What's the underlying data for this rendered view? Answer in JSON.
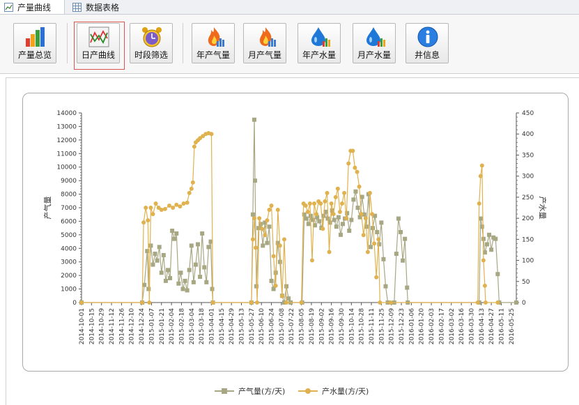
{
  "tabs": [
    {
      "label": "产量曲线",
      "icon": "chart-icon",
      "active": true
    },
    {
      "label": "数据表格",
      "icon": "table-icon",
      "active": false
    }
  ],
  "toolbar": {
    "buttons": [
      {
        "label": "产量总览",
        "icon": "bar-chart-icon"
      },
      {
        "label": "日产曲线",
        "icon": "line-chart-icon",
        "selected": true
      },
      {
        "label": "时段筛选",
        "icon": "alarm-clock-icon"
      },
      {
        "label": "年产气量",
        "icon": "flame-icon"
      },
      {
        "label": "月产气量",
        "icon": "flame-icon"
      },
      {
        "label": "年产水量",
        "icon": "water-drop-icon"
      },
      {
        "label": "月产水量",
        "icon": "water-drop-icon"
      },
      {
        "label": "井信息",
        "icon": "info-icon"
      }
    ]
  },
  "colors": {
    "gas": "#a7a783",
    "water": "#e0b24f",
    "selected_border": "#d9534f"
  },
  "chart_data": {
    "type": "line",
    "ylabel": "产气量",
    "y2label": "产水量",
    "ylim": [
      0,
      14000
    ],
    "y2lim": [
      0,
      450
    ],
    "yticks": [
      0,
      1000,
      2000,
      3000,
      4000,
      5000,
      6000,
      7000,
      8000,
      9000,
      10000,
      11000,
      12000,
      13000,
      14000
    ],
    "y2ticks": [
      0,
      50,
      100,
      150,
      200,
      250,
      300,
      350,
      400,
      450
    ],
    "x_start": "2014-10-01",
    "x_end": "2016-06-01",
    "x_ticks": [
      "2014-10-01",
      "2014-10-15",
      "2014-10-29",
      "2014-11-12",
      "2014-11-26",
      "2014-12-10",
      "2014-12-24",
      "2015-01-07",
      "2015-01-21",
      "2015-02-04",
      "2015-02-18",
      "2015-03-04",
      "2015-03-18",
      "2015-04-01",
      "2015-04-15",
      "2015-04-29",
      "2015-05-13",
      "2015-05-27",
      "2015-06-10",
      "2015-06-24",
      "2015-07-08",
      "2015-07-22",
      "2015-08-05",
      "2015-08-19",
      "2015-09-02",
      "2015-09-16",
      "2015-09-30",
      "2015-10-14",
      "2015-10-28",
      "2015-11-11",
      "2015-11-25",
      "2015-12-09",
      "2015-12-23",
      "2016-01-06",
      "2016-01-20",
      "2016-02-03",
      "2016-02-17",
      "2016-03-02",
      "2016-03-16",
      "2016-03-30",
      "2016-04-13",
      "2016-04-27",
      "2016-05-11",
      "2016-05-25"
    ],
    "grid": false,
    "legend_position": "bottom",
    "series": [
      {
        "name": "产气量(方/天)",
        "axis": "left",
        "marker": "square",
        "points": [
          [
            "2014-10-01",
            0
          ],
          [
            "2014-12-25",
            0
          ],
          [
            "2014-12-28",
            1300
          ],
          [
            "2015-01-01",
            3800
          ],
          [
            "2015-01-03",
            1000
          ],
          [
            "2015-01-06",
            4200
          ],
          [
            "2015-01-09",
            2800
          ],
          [
            "2015-01-12",
            3600
          ],
          [
            "2015-01-15",
            3100
          ],
          [
            "2015-01-18",
            4100
          ],
          [
            "2015-01-21",
            2200
          ],
          [
            "2015-01-24",
            3500
          ],
          [
            "2015-01-27",
            1600
          ],
          [
            "2015-01-30",
            2400
          ],
          [
            "2015-02-02",
            1800
          ],
          [
            "2015-02-05",
            5300
          ],
          [
            "2015-02-08",
            4700
          ],
          [
            "2015-02-11",
            5100
          ],
          [
            "2015-02-14",
            1400
          ],
          [
            "2015-02-17",
            2200
          ],
          [
            "2015-02-20",
            1000
          ],
          [
            "2015-02-23",
            1600
          ],
          [
            "2015-02-26",
            900
          ],
          [
            "2015-03-01",
            2400
          ],
          [
            "2015-03-04",
            4200
          ],
          [
            "2015-03-07",
            1500
          ],
          [
            "2015-03-10",
            2800
          ],
          [
            "2015-03-13",
            4300
          ],
          [
            "2015-03-16",
            1900
          ],
          [
            "2015-03-19",
            5100
          ],
          [
            "2015-03-22",
            2600
          ],
          [
            "2015-03-25",
            1500
          ],
          [
            "2015-03-28",
            4100
          ],
          [
            "2015-03-31",
            4500
          ],
          [
            "2015-04-02",
            1000
          ],
          [
            "2015-04-03",
            0
          ],
          [
            "2015-05-27",
            0
          ],
          [
            "2015-05-29",
            6500
          ],
          [
            "2015-05-31",
            13500
          ],
          [
            "2015-06-01",
            9000
          ],
          [
            "2015-06-03",
            1200
          ],
          [
            "2015-06-06",
            5500
          ],
          [
            "2015-06-09",
            5800
          ],
          [
            "2015-06-12",
            4200
          ],
          [
            "2015-06-15",
            5900
          ],
          [
            "2015-06-18",
            4400
          ],
          [
            "2015-06-21",
            5600
          ],
          [
            "2015-06-24",
            1600
          ],
          [
            "2015-06-27",
            1000
          ],
          [
            "2015-06-30",
            2200
          ],
          [
            "2015-07-03",
            4400
          ],
          [
            "2015-07-06",
            3000
          ],
          [
            "2015-07-09",
            500
          ],
          [
            "2015-07-12",
            0
          ],
          [
            "2015-07-15",
            1200
          ],
          [
            "2015-07-18",
            300
          ],
          [
            "2015-07-21",
            0
          ],
          [
            "2015-08-06",
            0
          ],
          [
            "2015-08-09",
            6500
          ],
          [
            "2015-08-12",
            6200
          ],
          [
            "2015-08-15",
            5800
          ],
          [
            "2015-08-18",
            6400
          ],
          [
            "2015-08-21",
            6100
          ],
          [
            "2015-08-24",
            5700
          ],
          [
            "2015-08-27",
            6300
          ],
          [
            "2015-08-30",
            6000
          ],
          [
            "2015-09-02",
            5500
          ],
          [
            "2015-09-05",
            6400
          ],
          [
            "2015-09-08",
            6700
          ],
          [
            "2015-09-11",
            6200
          ],
          [
            "2015-09-14",
            5900
          ],
          [
            "2015-09-17",
            6800
          ],
          [
            "2015-09-20",
            6100
          ],
          [
            "2015-09-23",
            5600
          ],
          [
            "2015-09-26",
            6300
          ],
          [
            "2015-09-29",
            5000
          ],
          [
            "2015-10-02",
            5800
          ],
          [
            "2015-10-05",
            6200
          ],
          [
            "2015-10-08",
            6600
          ],
          [
            "2015-10-11",
            5300
          ],
          [
            "2015-10-14",
            6100
          ],
          [
            "2015-10-17",
            7600
          ],
          [
            "2015-10-20",
            8200
          ],
          [
            "2015-10-23",
            7000
          ],
          [
            "2015-10-26",
            6300
          ],
          [
            "2015-10-29",
            7800
          ],
          [
            "2015-11-01",
            6500
          ],
          [
            "2015-11-04",
            5600
          ],
          [
            "2015-11-07",
            8000
          ],
          [
            "2015-11-10",
            4100
          ],
          [
            "2015-11-13",
            5500
          ],
          [
            "2015-11-16",
            6400
          ],
          [
            "2015-11-19",
            5200
          ],
          [
            "2015-11-22",
            4300
          ],
          [
            "2015-11-25",
            5900
          ],
          [
            "2015-11-28",
            3200
          ],
          [
            "2015-12-01",
            1200
          ],
          [
            "2015-12-04",
            0
          ],
          [
            "2015-12-13",
            0
          ],
          [
            "2015-12-16",
            3600
          ],
          [
            "2015-12-19",
            6200
          ],
          [
            "2015-12-22",
            5200
          ],
          [
            "2015-12-25",
            3100
          ],
          [
            "2015-12-28",
            4700
          ],
          [
            "2015-12-31",
            1100
          ],
          [
            "2016-01-01",
            0
          ],
          [
            "2016-04-10",
            0
          ],
          [
            "2016-04-12",
            6200
          ],
          [
            "2016-04-14",
            5600
          ],
          [
            "2016-04-16",
            4700
          ],
          [
            "2016-04-18",
            3700
          ],
          [
            "2016-04-21",
            4300
          ],
          [
            "2016-04-24",
            5000
          ],
          [
            "2016-04-27",
            3900
          ],
          [
            "2016-04-30",
            4800
          ],
          [
            "2016-05-03",
            4700
          ],
          [
            "2016-05-06",
            2100
          ],
          [
            "2016-05-08",
            0
          ],
          [
            "2016-06-01",
            0
          ]
        ]
      },
      {
        "name": "产水量(方/天)",
        "axis": "right",
        "marker": "circle",
        "points": [
          [
            "2014-10-01",
            0
          ],
          [
            "2014-12-25",
            0
          ],
          [
            "2014-12-27",
            190
          ],
          [
            "2014-12-30",
            225
          ],
          [
            "2015-01-02",
            195
          ],
          [
            "2015-01-04",
            0
          ],
          [
            "2015-01-06",
            225
          ],
          [
            "2015-01-09",
            210
          ],
          [
            "2015-01-13",
            235
          ],
          [
            "2015-01-17",
            225
          ],
          [
            "2015-01-21",
            220
          ],
          [
            "2015-01-26",
            222
          ],
          [
            "2015-02-01",
            230
          ],
          [
            "2015-02-06",
            225
          ],
          [
            "2015-02-11",
            232
          ],
          [
            "2015-02-16",
            228
          ],
          [
            "2015-02-21",
            235
          ],
          [
            "2015-02-26",
            237
          ],
          [
            "2015-03-01",
            260
          ],
          [
            "2015-03-04",
            270
          ],
          [
            "2015-03-06",
            285
          ],
          [
            "2015-03-08",
            370
          ],
          [
            "2015-03-10",
            380
          ],
          [
            "2015-03-13",
            385
          ],
          [
            "2015-03-16",
            390
          ],
          [
            "2015-03-20",
            395
          ],
          [
            "2015-03-24",
            400
          ],
          [
            "2015-03-28",
            402
          ],
          [
            "2015-04-01",
            400
          ],
          [
            "2015-04-03",
            0
          ],
          [
            "2015-05-27",
            0
          ],
          [
            "2015-05-29",
            150
          ],
          [
            "2015-05-31",
            200
          ],
          [
            "2015-06-02",
            130
          ],
          [
            "2015-06-04",
            0
          ],
          [
            "2015-06-07",
            200
          ],
          [
            "2015-06-11",
            175
          ],
          [
            "2015-06-15",
            160
          ],
          [
            "2015-06-18",
            195
          ],
          [
            "2015-06-21",
            220
          ],
          [
            "2015-06-24",
            230
          ],
          [
            "2015-06-27",
            110
          ],
          [
            "2015-06-30",
            40
          ],
          [
            "2015-07-03",
            220
          ],
          [
            "2015-07-06",
            135
          ],
          [
            "2015-07-09",
            15
          ],
          [
            "2015-07-12",
            150
          ],
          [
            "2015-07-15",
            0
          ],
          [
            "2015-08-05",
            0
          ],
          [
            "2015-08-08",
            235
          ],
          [
            "2015-08-11",
            230
          ],
          [
            "2015-08-14",
            215
          ],
          [
            "2015-08-17",
            235
          ],
          [
            "2015-08-20",
            100
          ],
          [
            "2015-08-23",
            235
          ],
          [
            "2015-08-26",
            210
          ],
          [
            "2015-08-29",
            240
          ],
          [
            "2015-09-01",
            235
          ],
          [
            "2015-09-04",
            175
          ],
          [
            "2015-09-07",
            240
          ],
          [
            "2015-09-10",
            260
          ],
          [
            "2015-09-13",
            120
          ],
          [
            "2015-09-16",
            235
          ],
          [
            "2015-09-19",
            210
          ],
          [
            "2015-09-22",
            250
          ],
          [
            "2015-09-25",
            270
          ],
          [
            "2015-09-28",
            215
          ],
          [
            "2015-10-01",
            235
          ],
          [
            "2015-10-04",
            260
          ],
          [
            "2015-10-07",
            200
          ],
          [
            "2015-10-10",
            330
          ],
          [
            "2015-10-13",
            360
          ],
          [
            "2015-10-16",
            360
          ],
          [
            "2015-10-19",
            320
          ],
          [
            "2015-10-22",
            310
          ],
          [
            "2015-10-25",
            275
          ],
          [
            "2015-10-28",
            210
          ],
          [
            "2015-10-31",
            160
          ],
          [
            "2015-11-03",
            200
          ],
          [
            "2015-11-06",
            120
          ],
          [
            "2015-11-09",
            260
          ],
          [
            "2015-11-12",
            210
          ],
          [
            "2015-11-15",
            140
          ],
          [
            "2015-11-18",
            60
          ],
          [
            "2015-11-21",
            150
          ],
          [
            "2015-11-23",
            0
          ],
          [
            "2015-12-08",
            0
          ],
          [
            "2016-04-08",
            0
          ],
          [
            "2016-04-10",
            235
          ],
          [
            "2016-04-12",
            300
          ],
          [
            "2016-04-14",
            325
          ],
          [
            "2016-04-16",
            100
          ],
          [
            "2016-04-18",
            40
          ],
          [
            "2016-04-19",
            0
          ],
          [
            "2016-05-06",
            0
          ]
        ]
      }
    ]
  }
}
